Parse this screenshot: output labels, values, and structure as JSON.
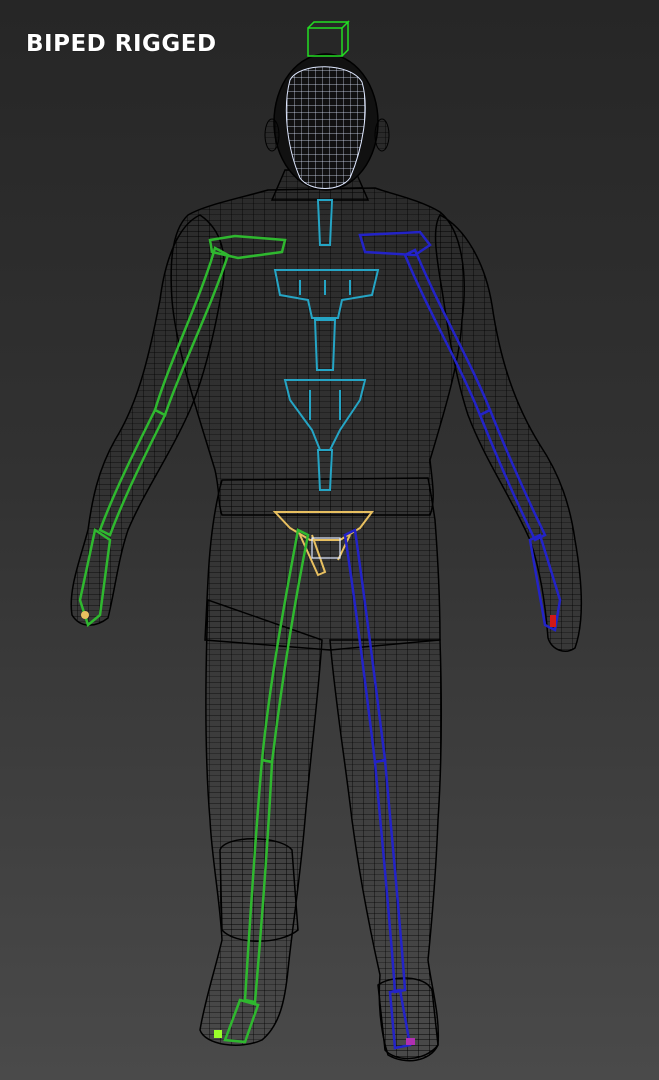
{
  "viewport": {
    "label": "BIPED RIGGED",
    "background_top": "#262626",
    "background_bottom": "#4a4a4a"
  },
  "rig_colors": {
    "mesh_wireframe": "#000000",
    "head_wireframe": "#dfe8ff",
    "head_control": "#22dd22",
    "spine": "#25a5c5",
    "pelvis": "#e8c060",
    "left_side_bones": "#2fb82f",
    "right_side_bones": "#2323c8",
    "right_finger_accent": "#d01818",
    "toe_accent_left": "#9aff2a",
    "toe_accent_right": "#b030b0"
  }
}
